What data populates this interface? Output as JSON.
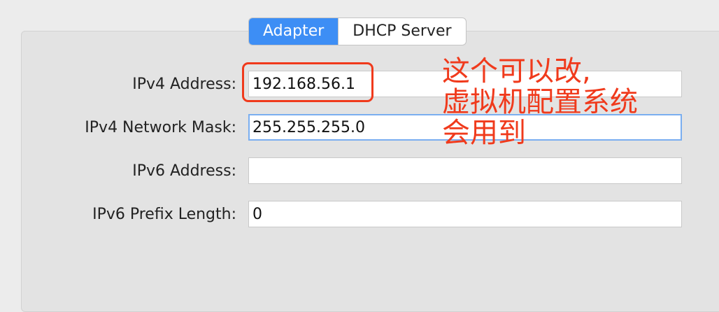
{
  "tabs": [
    {
      "label": "Adapter"
    },
    {
      "label": "DHCP Server"
    }
  ],
  "form": {
    "ipv4_address": {
      "label": "IPv4 Address:",
      "value": "192.168.56.1"
    },
    "ipv4_mask": {
      "label": "IPv4 Network Mask:",
      "value": "255.255.255.0"
    },
    "ipv6_address": {
      "label": "IPv6 Address:",
      "value": ""
    },
    "ipv6_prefix": {
      "label": "IPv6 Prefix Length:",
      "value": "0"
    }
  },
  "annotation": {
    "lines": [
      "这个可以改,",
      "虚拟机配置系统",
      "会用到"
    ],
    "color": "#f03a1c"
  },
  "colors": {
    "accent": "#3d8ef5",
    "focus_ring": "#7aaef0"
  }
}
